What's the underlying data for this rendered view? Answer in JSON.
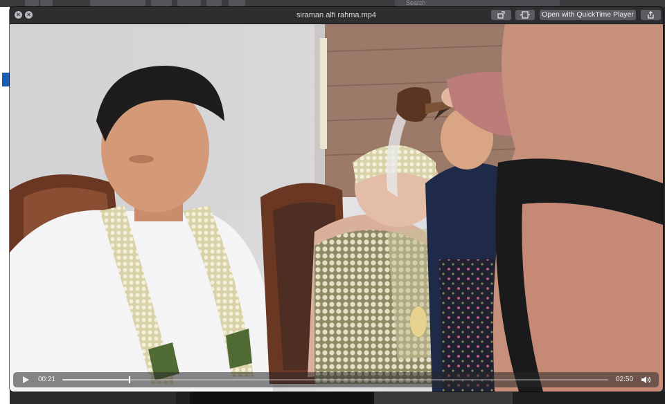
{
  "window": {
    "title": "siraman alfi rahma.mp4",
    "open_with_label": "Open with QuickTime Player"
  },
  "icons": {
    "close": "close-icon",
    "minimize": "minimize-icon",
    "rotate": "rotate-icon",
    "trim": "trim-icon",
    "share": "share-icon",
    "play": "play-icon",
    "volume": "volume-icon"
  },
  "playback": {
    "current_time": "00:21",
    "duration": "02:50",
    "progress": 0.1235
  },
  "background": {
    "search_placeholder": "Search"
  },
  "colors": {
    "titlebar": "#2e2e30",
    "button": "#5c5c60",
    "controls": "#28282a"
  }
}
